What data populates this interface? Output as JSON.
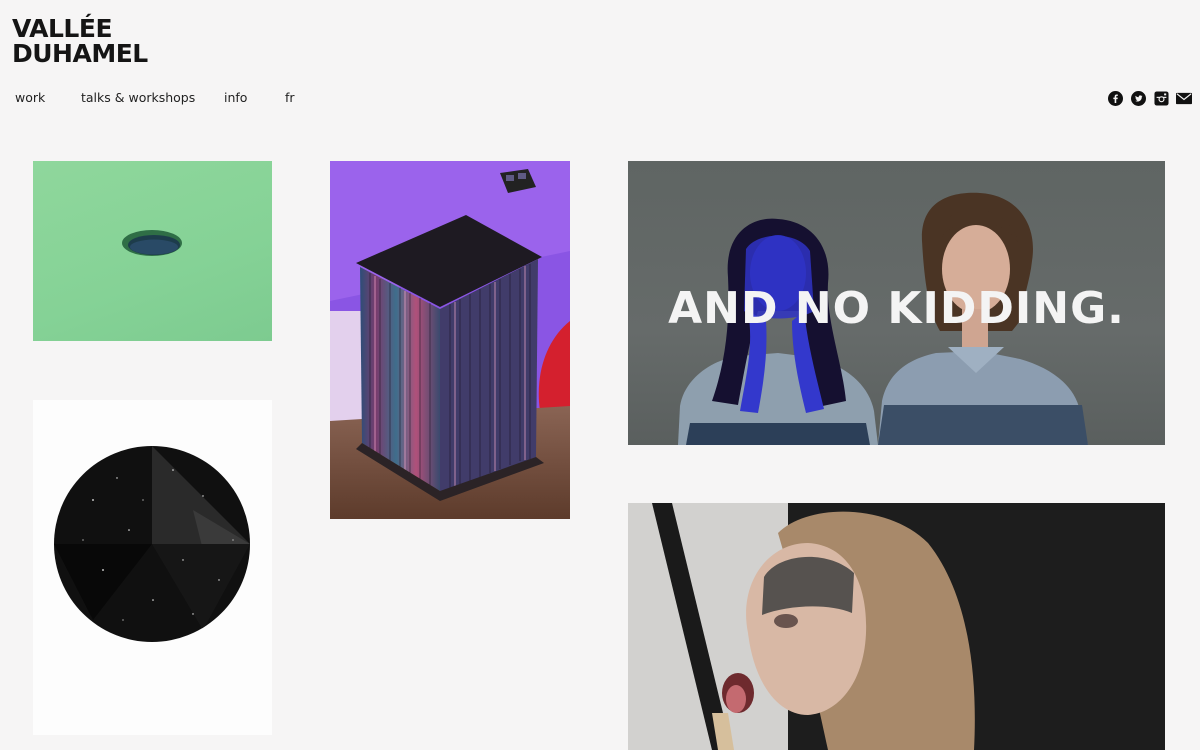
{
  "brand": {
    "line1": "VALLÉE",
    "line2": "DUHAMEL"
  },
  "nav": {
    "items": [
      {
        "label": "work"
      },
      {
        "label": "talks & workshops"
      },
      {
        "label": "info"
      },
      {
        "label": "fr"
      }
    ]
  },
  "social": {
    "icons": [
      "facebook-icon",
      "twitter-icon",
      "instagram-icon",
      "mail-icon"
    ]
  },
  "portfolio": {
    "poster_headline": "AND NO KIDDING."
  }
}
